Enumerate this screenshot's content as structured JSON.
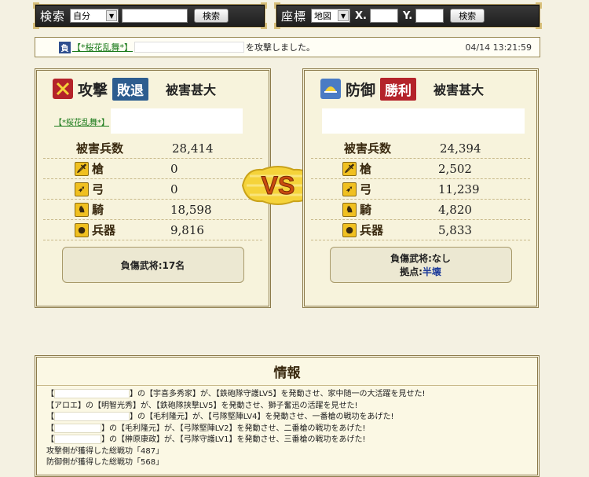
{
  "search_bar": {
    "label": "検索",
    "select_value": "自分",
    "button": "検索"
  },
  "coord_bar": {
    "label": "座標",
    "select_value": "地図",
    "x_label": "X.",
    "y_label": "Y.",
    "button": "検索"
  },
  "message": {
    "badge": "負",
    "alliance": "【*桜花乱舞*】",
    "text": "を攻撃しました。",
    "timestamp": "04/14 13:21:59"
  },
  "attack": {
    "title": "攻撃",
    "result": "敗退",
    "damage_level": "被害甚大",
    "alliance": "【*桜花乱舞*】",
    "lost_label": "被害兵数",
    "lost_total": "28,414",
    "units": [
      {
        "label": "槍",
        "value": "0"
      },
      {
        "label": "弓",
        "value": "0"
      },
      {
        "label": "騎",
        "value": "18,598"
      },
      {
        "label": "兵器",
        "value": "9,816"
      }
    ],
    "summary_line1": "負傷武将:17名"
  },
  "defense": {
    "title": "防御",
    "result": "勝利",
    "damage_level": "被害甚大",
    "lost_label": "被害兵数",
    "lost_total": "24,394",
    "units": [
      {
        "label": "槍",
        "value": "2,502"
      },
      {
        "label": "弓",
        "value": "11,239"
      },
      {
        "label": "騎",
        "value": "4,820"
      },
      {
        "label": "兵器",
        "value": "5,833"
      }
    ],
    "summary_line1": "負傷武将:なし",
    "summary_base_label": "拠点:",
    "summary_base_value": "半壊"
  },
  "vs_text": "VS",
  "info": {
    "title": "情報",
    "lines": [
      {
        "pre": "【",
        "post": "】の【宇喜多秀家】が、【鉄砲隊守護LV5】を発動させ、家中随一の大活躍を見せた!"
      },
      {
        "pre": "【アロエ】の【明智光秀】が、【鉄砲隊挟撃LV5】を発動させ、獅子奮迅の活躍を見せた!",
        "post": ""
      },
      {
        "pre": "【",
        "post": "】の【毛利隆元】が、【弓隊堅陣LV4】を発動させ、一番槍の戦功をあげた!"
      },
      {
        "pre": "【",
        "post": "】の【毛利隆元】が、【弓隊堅陣LV2】を発動させ、二番槍の戦功をあげた!"
      },
      {
        "pre": "【",
        "post": "】の【榊原康政】が、【弓隊守護LV1】を発動させ、三番槍の戦功をあげた!"
      },
      {
        "pre": "攻撃側が獲得した総戦功「487」",
        "post": ""
      },
      {
        "pre": "防御側が獲得した総戦功「568」",
        "post": ""
      }
    ]
  },
  "colors": {
    "defeat": "#2d5d8f",
    "victory": "#b4232a",
    "gold": "#f5d33a"
  }
}
